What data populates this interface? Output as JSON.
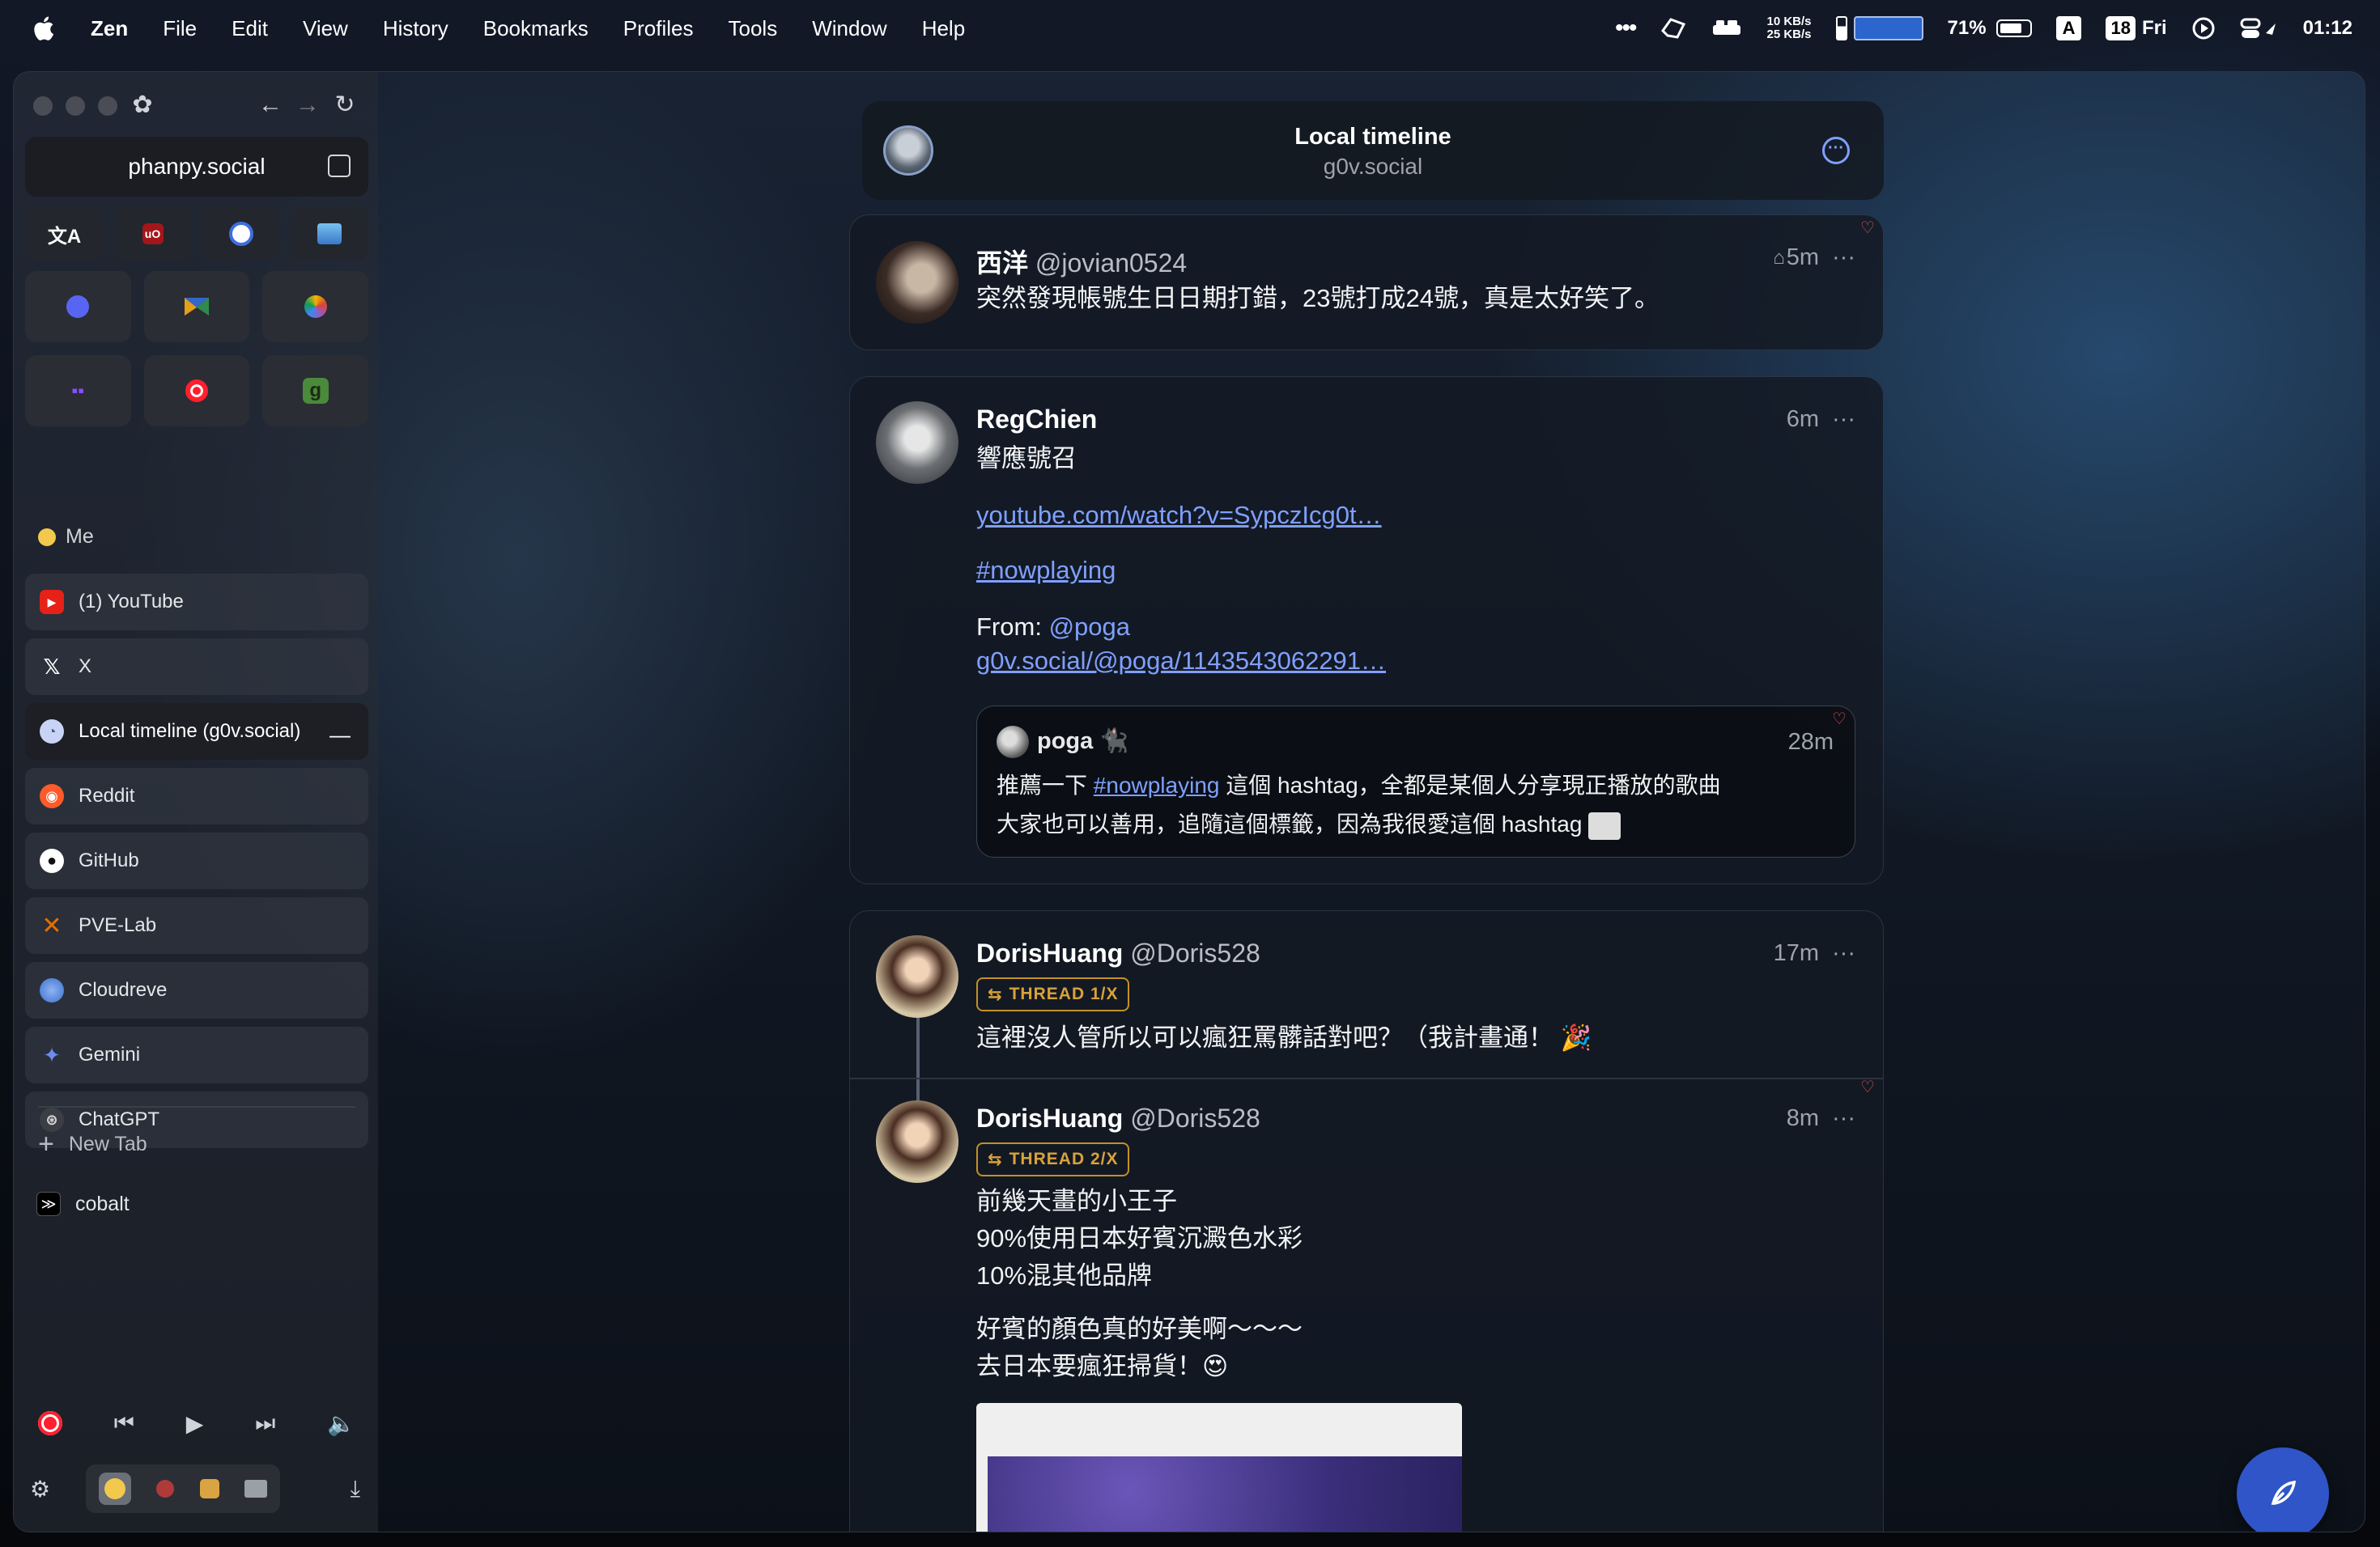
{
  "menubar": {
    "app": "Zen",
    "items": [
      "File",
      "Edit",
      "View",
      "History",
      "Bookmarks",
      "Profiles",
      "Tools",
      "Window",
      "Help"
    ],
    "net_up": "10 KB/s",
    "net_down": "25 KB/s",
    "battery": "71%",
    "input_source": "A",
    "date_num": "18",
    "day": "Fri",
    "time": "01:12"
  },
  "sidebar": {
    "url": "phanpy.social",
    "workspace": "Me",
    "tabs": [
      {
        "label": "(1) YouTube",
        "color": "#e62117",
        "glyph": "▶"
      },
      {
        "label": "X",
        "color": "#222",
        "glyph": "𝕏"
      },
      {
        "label": "Local timeline (g0v.social)",
        "color": "#6b7a99",
        "glyph": "◔"
      },
      {
        "label": "Reddit",
        "color": "#ff5a2a",
        "glyph": "◉"
      },
      {
        "label": "GitHub",
        "color": "#111",
        "glyph": "●"
      },
      {
        "label": "PVE-Lab",
        "color": "#e57000",
        "glyph": "✕"
      },
      {
        "label": "Cloudreve",
        "color": "#3b6fd1",
        "glyph": "◐"
      },
      {
        "label": "Gemini",
        "color": "#4e76e6",
        "glyph": "✦"
      },
      {
        "label": "ChatGPT",
        "color": "#555",
        "glyph": "⊛"
      }
    ],
    "new_tab": "New Tab",
    "cobalt": "cobalt"
  },
  "timeline": {
    "title": "Local timeline",
    "server": "g0v.social"
  },
  "posts": [
    {
      "name": "西洋",
      "handle": "@jovian0524",
      "time": "5m",
      "text": "突然發現帳號生日日期打錯，23號打成24號，真是太好笑了。"
    },
    {
      "name": "RegChien",
      "time": "6m",
      "line1": "響應號召",
      "link1": "youtube.com/watch?v=SypczIcg0t…",
      "hashtag": "#nowplaying",
      "from_label": "From:",
      "from_user": "@poga",
      "link2": "g0v.social/@poga/1143543062291…",
      "quote": {
        "name": "poga 🐈‍⬛",
        "time": "28m",
        "line1_a": "推薦一下",
        "line1_tag": "#nowplaying",
        "line1_b": "這個 hashtag，全都是某個人分享現正播放的歌曲",
        "line2": "大家也可以善用，追隨這個標籤，因為我很愛這個 hashtag"
      }
    },
    {
      "name": "DorisHuang",
      "handle": "@Doris528",
      "time": "17m",
      "badge": "THREAD 1/X",
      "text": "這裡沒人管所以可以瘋狂罵髒話對吧？（我計畫通！ 🎉"
    },
    {
      "name": "DorisHuang",
      "handle": "@Doris528",
      "time": "8m",
      "badge": "THREAD 2/X",
      "lines": [
        "前幾天畫的小王子",
        "90%使用日本好賓沉澱色水彩",
        "10%混其他品牌"
      ],
      "lines2": [
        "好賓的顏色真的好美啊～～～",
        "去日本要瘋狂掃貨！😍"
      ]
    }
  ]
}
